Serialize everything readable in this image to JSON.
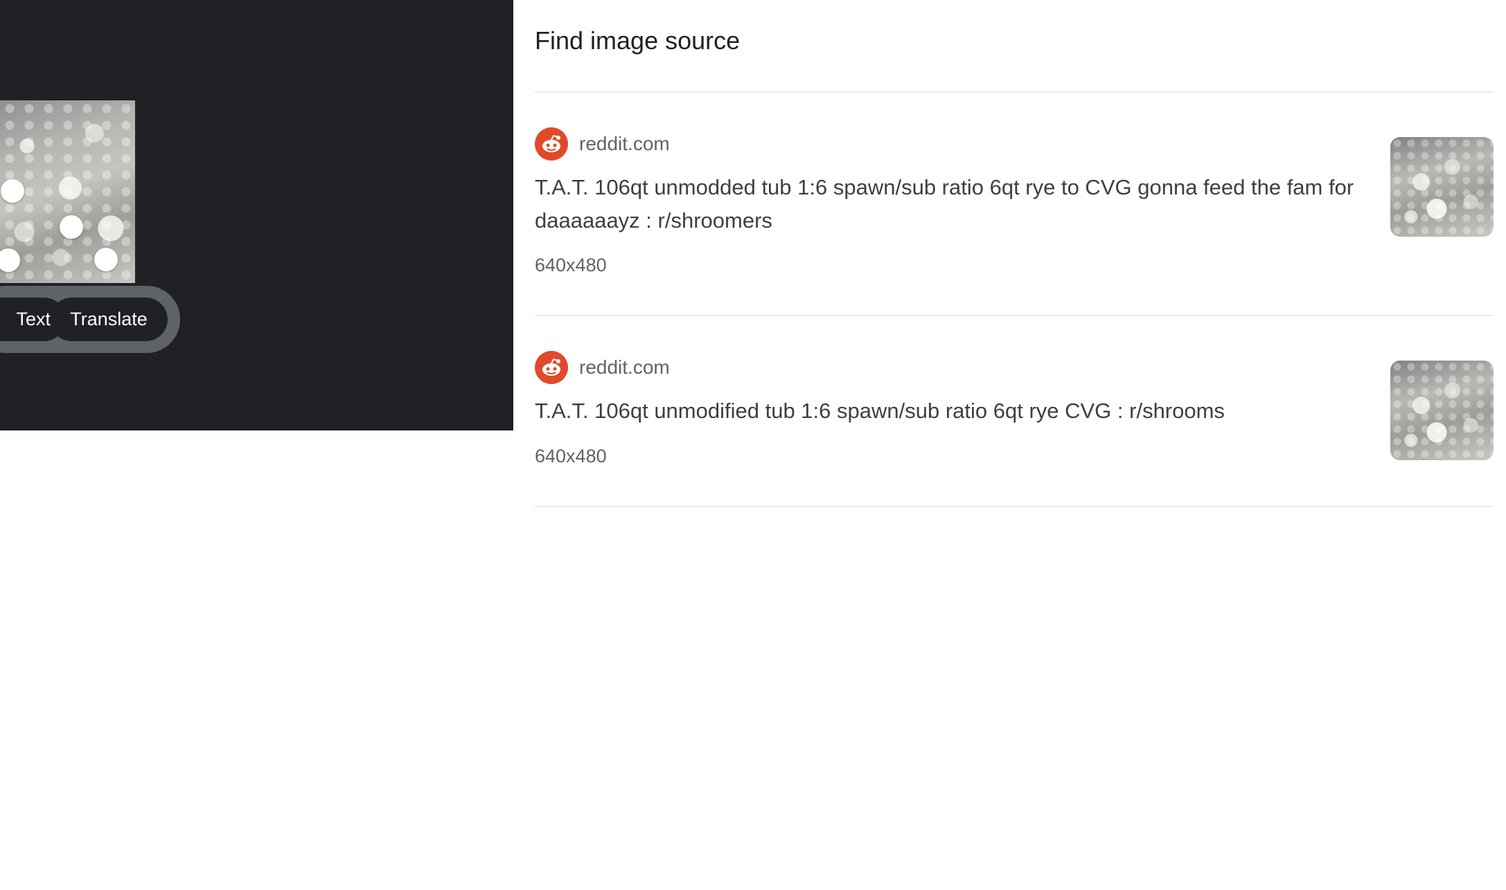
{
  "panel": {
    "title": "Find image source"
  },
  "lens_actions": {
    "text_chip": "Text",
    "translate_chip": "Translate"
  },
  "results": [
    {
      "site": "reddit.com",
      "title": "T.A.T. 106qt unmodded tub 1:6 spawn/sub ratio 6qt rye to CVG gonna feed the fam for daaaaaayz : r/shroomers",
      "size": "640x480",
      "icon": "reddit-icon"
    },
    {
      "site": "reddit.com",
      "title": "T.A.T. 106qt unmodified tub 1:6 spawn/sub ratio 6qt rye CVG : r/shrooms",
      "size": "640x480",
      "icon": "reddit-icon"
    }
  ],
  "colors": {
    "dark_panel": "#202124",
    "chip_container": "#5f6368",
    "reddit_brand": "#e0492a",
    "divider": "#e8eaed"
  }
}
